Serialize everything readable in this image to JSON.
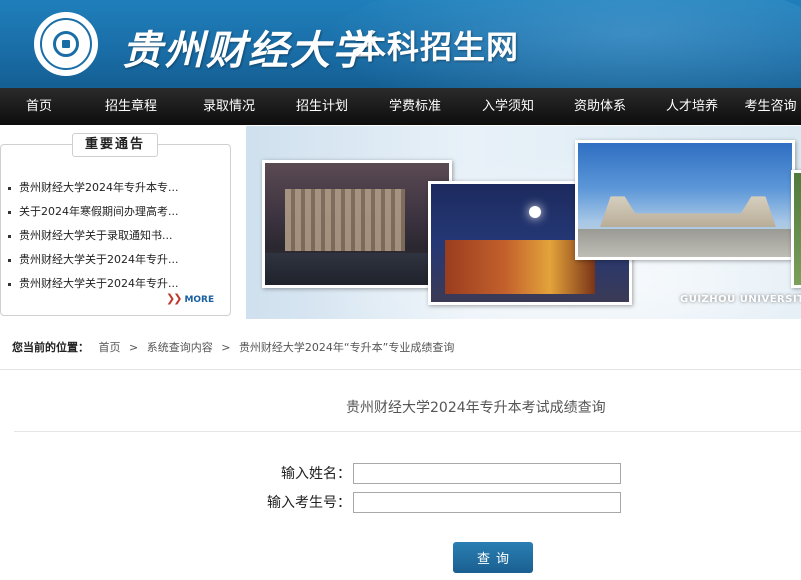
{
  "header": {
    "brand_script": "贵州财经大学",
    "site_title": "本科招生网"
  },
  "nav": {
    "items": [
      {
        "label": "首页"
      },
      {
        "label": "招生章程"
      },
      {
        "label": "录取情况"
      },
      {
        "label": "招生计划"
      },
      {
        "label": "学费标准"
      },
      {
        "label": "入学须知"
      },
      {
        "label": "资助体系"
      },
      {
        "label": "人才培养"
      },
      {
        "label": "考生咨询"
      }
    ]
  },
  "notice": {
    "title": "重要通告",
    "items": [
      {
        "text": "贵州财经大学2024年专升本专..."
      },
      {
        "text": "关于2024年寒假期间办理高考..."
      },
      {
        "text": "贵州财经大学关于录取通知书..."
      },
      {
        "text": "贵州财经大学关于2024年专升..."
      },
      {
        "text": "贵州财经大学关于2024年专升..."
      }
    ],
    "more": "MORE"
  },
  "banner": {
    "caption": "GUIZHOU UNIVERSITY"
  },
  "breadcrumb": {
    "label": "您当前的位置：",
    "items": [
      "首页",
      "系统查询内容",
      "贵州财经大学2024年“专升本”专业成绩查询"
    ],
    "separator": ">"
  },
  "query": {
    "title": "贵州财经大学2024年专升本考试成绩查询",
    "name_label": "输入姓名：",
    "name_value": "",
    "exam_label": "输入考生号：",
    "exam_value": "",
    "submit_label": "查询"
  },
  "colors": {
    "header_blue": "#1a6ea8",
    "nav_black": "#111111",
    "button_blue": "#1f6c9f",
    "more_arrow": "#c0392b"
  }
}
